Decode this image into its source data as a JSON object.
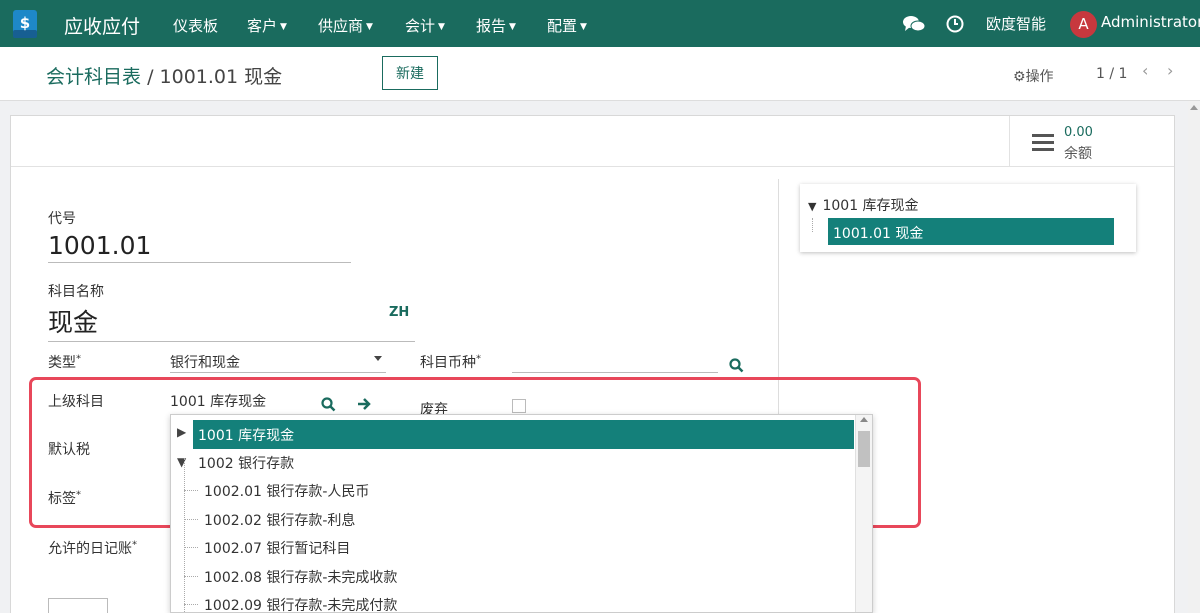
{
  "navbar": {
    "app_name": "应收应付",
    "menus": [
      "仪表板",
      "客户",
      "供应商",
      "会计",
      "报告",
      "配置"
    ],
    "company": "欧度智能",
    "avatar_letter": "A",
    "user": "Administrator",
    "brand_color": "#1a6b5e"
  },
  "control": {
    "breadcrumb_parent": "会计科目表",
    "breadcrumb_sep": "/",
    "breadcrumb_current": "1001.01 现金",
    "new_button": "新建",
    "actions_label": "操作",
    "pager": "1 / 1"
  },
  "stat": {
    "value": "0.00",
    "label": "余额"
  },
  "form": {
    "code_label": "代号",
    "code_value": "1001.01",
    "name_label": "科目名称",
    "name_value": "现金",
    "lang_button": "ZH",
    "type_label": "类型",
    "type_value": "银行和现金",
    "currency_label": "科目币种",
    "parent_label": "上级科目",
    "parent_value": "1001 库存现金",
    "deprecated_label": "废弃",
    "default_tax_label": "默认税",
    "tags_label": "标签",
    "journals_label": "允许的日记账",
    "required_mark": "*"
  },
  "tree": {
    "root": "1001 库存现金",
    "selected": "1001.01 现金"
  },
  "dropdown": {
    "items": [
      "1001 库存现金",
      "1002 银行存款",
      "1002.01 银行存款-人民币",
      "1002.02 银行存款-利息",
      "1002.07 银行暂记科目",
      "1002.08 银行存款-未完成收款",
      "1002.09 银行存款-未完成付款"
    ]
  },
  "colors": {
    "highlight": "#e8475a",
    "selection": "#14807a"
  }
}
